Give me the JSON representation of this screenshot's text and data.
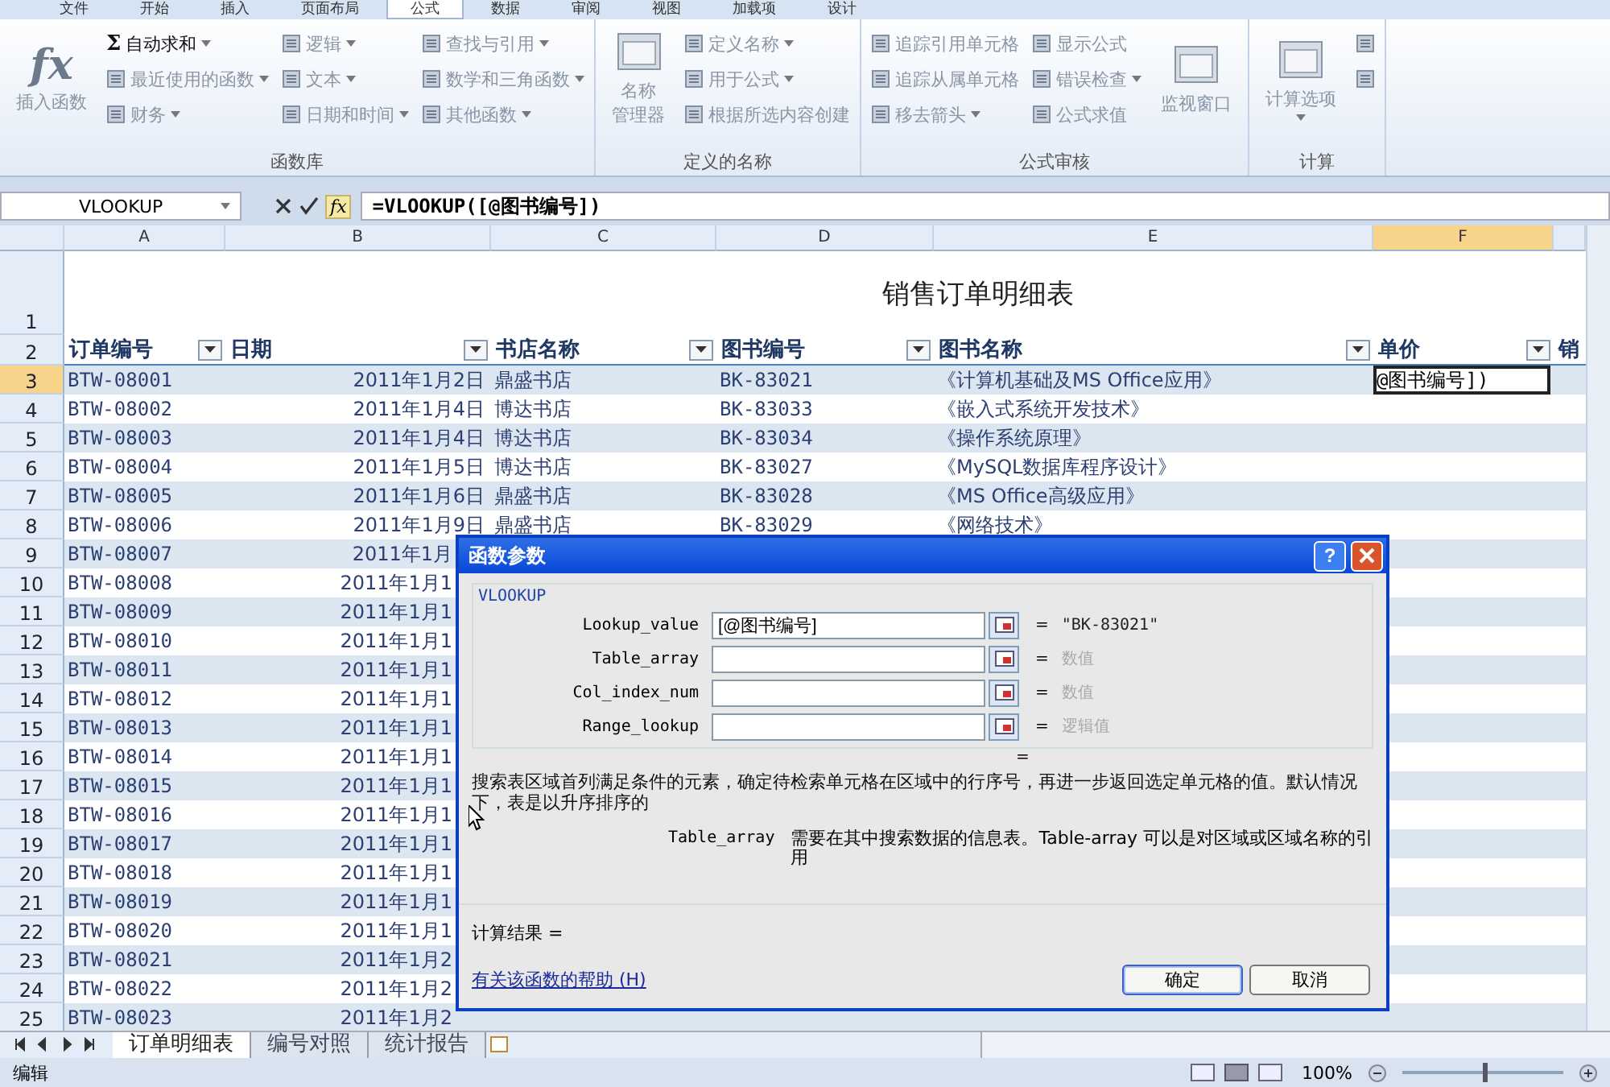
{
  "ribbon_tabs": [
    {
      "label": "文件",
      "selected": false
    },
    {
      "label": "开始",
      "selected": false
    },
    {
      "label": "插入",
      "selected": false
    },
    {
      "label": "页面布局",
      "selected": false
    },
    {
      "label": "公式",
      "selected": true
    },
    {
      "label": "数据",
      "selected": false
    },
    {
      "label": "审阅",
      "selected": false
    },
    {
      "label": "视图",
      "selected": false
    },
    {
      "label": "加载项",
      "selected": false
    },
    {
      "label": "设计",
      "selected": false
    }
  ],
  "ribbon_groups": [
    {
      "label": "函数库",
      "items": [
        {
          "kind": "large",
          "glyph": "fx",
          "label": "插入函数",
          "disabled": true,
          "dropdown": false
        },
        {
          "kind": "small",
          "glyph": "Σ",
          "label": "自动求和",
          "disabled": false,
          "dropdown": true
        },
        {
          "kind": "small",
          "label": "最近使用的函数",
          "disabled": true,
          "dropdown": true
        },
        {
          "kind": "small",
          "label": "财务",
          "disabled": true,
          "dropdown": true
        },
        {
          "kind": "small",
          "label": "逻辑",
          "disabled": true,
          "dropdown": true
        },
        {
          "kind": "small",
          "label": "文本",
          "disabled": true,
          "dropdown": true
        },
        {
          "kind": "small",
          "label": "日期和时间",
          "disabled": true,
          "dropdown": true
        },
        {
          "kind": "small",
          "label": "查找与引用",
          "disabled": true,
          "dropdown": true
        },
        {
          "kind": "small",
          "label": "数学和三角函数",
          "disabled": true,
          "dropdown": true
        },
        {
          "kind": "small",
          "label": "其他函数",
          "disabled": true,
          "dropdown": true
        }
      ]
    },
    {
      "label": "定义的名称",
      "items": [
        {
          "kind": "large",
          "label": "名称管理器",
          "disabled": true,
          "dropdown": false
        },
        {
          "kind": "small",
          "label": "定义名称",
          "disabled": true,
          "dropdown": true
        },
        {
          "kind": "small",
          "label": "用于公式",
          "disabled": true,
          "dropdown": true
        },
        {
          "kind": "small",
          "label": "根据所选内容创建",
          "disabled": true,
          "dropdown": false
        }
      ]
    },
    {
      "label": "公式审核",
      "items": [
        {
          "kind": "small",
          "label": "追踪引用单元格",
          "disabled": true,
          "dropdown": false
        },
        {
          "kind": "small",
          "label": "追踪从属单元格",
          "disabled": true,
          "dropdown": false
        },
        {
          "kind": "small",
          "label": "移去箭头",
          "disabled": true,
          "dropdown": true
        },
        {
          "kind": "small",
          "label": "显示公式",
          "disabled": true,
          "dropdown": false
        },
        {
          "kind": "small",
          "label": "错误检查",
          "disabled": true,
          "dropdown": true
        },
        {
          "kind": "small",
          "label": "公式求值",
          "disabled": true,
          "dropdown": false
        },
        {
          "kind": "large",
          "label": "监视窗口",
          "disabled": true,
          "dropdown": false
        }
      ]
    },
    {
      "label": "计算",
      "items": [
        {
          "kind": "large",
          "label": "计算选项",
          "disabled": true,
          "dropdown": true
        },
        {
          "kind": "icon",
          "disabled": true,
          "dropdown": false
        },
        {
          "kind": "icon",
          "disabled": true,
          "dropdown": false
        }
      ]
    }
  ],
  "formula_bar": {
    "name_box": "VLOOKUP",
    "fx_button": "fx",
    "formula": "=VLOOKUP([@图书编号])"
  },
  "columns": [
    {
      "label": "A",
      "selected": false
    },
    {
      "label": "B",
      "selected": false
    },
    {
      "label": "C",
      "selected": false
    },
    {
      "label": "D",
      "selected": false
    },
    {
      "label": "E",
      "selected": false
    },
    {
      "label": "F",
      "selected": true
    }
  ],
  "title_row": {
    "number": "1",
    "title": "销售订单明细表"
  },
  "header_row": {
    "number": "2",
    "cells": [
      "订单编号",
      "日期",
      "书店名称",
      "图书编号",
      "图书名称",
      "单价",
      "销"
    ]
  },
  "rows": [
    {
      "number": "3",
      "selected": true,
      "behind_dialog": false,
      "cells": [
        "BTW-08001",
        "2011年1月2日",
        "鼎盛书店",
        "BK-83021",
        "《计算机基础及MS Office应用》",
        "@图书编号])"
      ]
    },
    {
      "number": "4",
      "selected": false,
      "behind_dialog": false,
      "cells": [
        "BTW-08002",
        "2011年1月4日",
        "博达书店",
        "BK-83033",
        "《嵌入式系统开发技术》"
      ]
    },
    {
      "number": "5",
      "selected": false,
      "behind_dialog": false,
      "cells": [
        "BTW-08003",
        "2011年1月4日",
        "博达书店",
        "BK-83034",
        "《操作系统原理》"
      ]
    },
    {
      "number": "6",
      "selected": false,
      "behind_dialog": false,
      "cells": [
        "BTW-08004",
        "2011年1月5日",
        "博达书店",
        "BK-83027",
        "《MySQL数据库程序设计》"
      ]
    },
    {
      "number": "7",
      "selected": false,
      "behind_dialog": false,
      "cells": [
        "BTW-08005",
        "2011年1月6日",
        "鼎盛书店",
        "BK-83028",
        "《MS Office高级应用》"
      ]
    },
    {
      "number": "8",
      "selected": false,
      "behind_dialog": false,
      "cells": [
        "BTW-08006",
        "2011年1月9日",
        "鼎盛书店",
        "BK-83029",
        "《网络技术》"
      ]
    },
    {
      "number": "9",
      "selected": false,
      "behind_dialog": true,
      "cells": [
        "BTW-08007",
        "2011年1月"
      ]
    },
    {
      "number": "10",
      "selected": false,
      "behind_dialog": true,
      "cells": [
        "BTW-08008",
        "2011年1月1"
      ]
    },
    {
      "number": "11",
      "selected": false,
      "behind_dialog": true,
      "cells": [
        "BTW-08009",
        "2011年1月1"
      ]
    },
    {
      "number": "12",
      "selected": false,
      "behind_dialog": true,
      "cells": [
        "BTW-08010",
        "2011年1月1"
      ]
    },
    {
      "number": "13",
      "selected": false,
      "behind_dialog": true,
      "cells": [
        "BTW-08011",
        "2011年1月1"
      ]
    },
    {
      "number": "14",
      "selected": false,
      "behind_dialog": true,
      "cells": [
        "BTW-08012",
        "2011年1月1"
      ]
    },
    {
      "number": "15",
      "selected": false,
      "behind_dialog": true,
      "cells": [
        "BTW-08013",
        "2011年1月1"
      ]
    },
    {
      "number": "16",
      "selected": false,
      "behind_dialog": true,
      "cells": [
        "BTW-08014",
        "2011年1月1"
      ]
    },
    {
      "number": "17",
      "selected": false,
      "behind_dialog": true,
      "cells": [
        "BTW-08015",
        "2011年1月1"
      ]
    },
    {
      "number": "18",
      "selected": false,
      "behind_dialog": true,
      "cells": [
        "BTW-08016",
        "2011年1月1"
      ]
    },
    {
      "number": "19",
      "selected": false,
      "behind_dialog": true,
      "cells": [
        "BTW-08017",
        "2011年1月1"
      ]
    },
    {
      "number": "20",
      "selected": false,
      "behind_dialog": true,
      "cells": [
        "BTW-08018",
        "2011年1月1"
      ]
    },
    {
      "number": "21",
      "selected": false,
      "behind_dialog": true,
      "cells": [
        "BTW-08019",
        "2011年1月1"
      ]
    },
    {
      "number": "22",
      "selected": false,
      "behind_dialog": true,
      "cells": [
        "BTW-08020",
        "2011年1月1"
      ]
    },
    {
      "number": "23",
      "selected": false,
      "behind_dialog": true,
      "cells": [
        "BTW-08021",
        "2011年1月2"
      ]
    },
    {
      "number": "24",
      "selected": false,
      "behind_dialog": true,
      "cells": [
        "BTW-08022",
        "2011年1月2"
      ]
    },
    {
      "number": "25",
      "selected": false,
      "behind_dialog": true,
      "cells": [
        "BTW-08023",
        "2011年1月2"
      ]
    }
  ],
  "sheet_tabs": [
    {
      "label": "订单明细表",
      "selected": true
    },
    {
      "label": "编号对照",
      "selected": false
    },
    {
      "label": "统计报告",
      "selected": false
    }
  ],
  "status_bar": {
    "mode": "编辑",
    "zoom": "100%",
    "zoom_slider": {
      "level": 0.5
    }
  },
  "dialog": {
    "title": "函数参数",
    "help_button": "?",
    "function_name": "VLOOKUP",
    "arguments": [
      {
        "name": "Lookup_value",
        "value": "[@图书编号]",
        "equals": "=",
        "result": "\"BK-83021\"",
        "dimmed": false
      },
      {
        "name": "Table_array",
        "equals": "=",
        "result": "数值",
        "dimmed": true
      },
      {
        "name": "Col_index_num",
        "equals": "=",
        "result": "数值",
        "dimmed": true
      },
      {
        "name": "Range_lookup",
        "equals": "=",
        "result": "逻辑值",
        "dimmed": true
      }
    ],
    "formula_result": "=",
    "description": "搜索表区域首列满足条件的元素，确定待检索单元格在区域中的行序号，再进一步返回选定单元格的值。默认情况下，表是以升序排序的",
    "argument_help": {
      "name": "Table_array",
      "text": "需要在其中搜索数据的信息表。Table-array 可以是对区域或区域名称的引用"
    },
    "result_label": "计算结果 =",
    "help_link": "有关该函数的帮助 (H)",
    "buttons": [
      {
        "label": "确定",
        "default": true
      },
      {
        "label": "取消",
        "default": false
      }
    ]
  }
}
